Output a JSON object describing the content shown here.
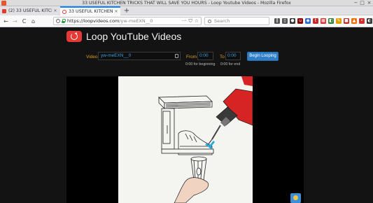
{
  "window": {
    "title": "33 USEFUL KITCHEN TRICKS THAT WILL SAVE YOU HOURS - Loop Youtube Videos - Mozilla Firefox",
    "controls": [
      "−",
      "□",
      "×"
    ]
  },
  "tabs": [
    {
      "label": "(2) 33 USEFUL KITCHEN",
      "active": false,
      "close": "×"
    },
    {
      "label": "33 USEFUL KITCHEN TR",
      "active": true,
      "close": "×"
    }
  ],
  "new_tab": "+",
  "nav": {
    "back": "←",
    "forward": "→",
    "reload": "C",
    "home": "⌂",
    "url_host": "https://loopvideos.com",
    "url_path": "/yw-meEXN__0",
    "url_actions": [
      "···",
      "⛉",
      "☆"
    ],
    "search_placeholder": "Search"
  },
  "toolbar_icons": [
    {
      "name": "library-icon",
      "color": "#555555",
      "glyph": "‖"
    },
    {
      "name": "sidebar-icon",
      "color": "#555555",
      "glyph": "▯"
    },
    {
      "name": "ext-dark-icon",
      "color": "#333333",
      "glyph": "●"
    },
    {
      "name": "ext-ublock-icon",
      "color": "#8b0000",
      "glyph": "u"
    },
    {
      "name": "ext-blue-icon",
      "color": "#2f6fc9",
      "glyph": "◆"
    },
    {
      "name": "ext-tag-icon",
      "color": "#c62828",
      "glyph": "t"
    },
    {
      "name": "ext-grid-icon",
      "color": "#d32f2f",
      "glyph": "▦"
    },
    {
      "name": "ext-green-icon",
      "color": "#2e7d32",
      "glyph": "◧"
    },
    {
      "name": "ext-pen-icon",
      "color": "#e0a000",
      "glyph": "✎"
    },
    {
      "name": "ext-square-icon",
      "color": "#c62828",
      "glyph": "■"
    },
    {
      "name": "ext-orange-icon",
      "color": "#ef6c00",
      "glyph": "▲"
    },
    {
      "name": "ext-lastpass-icon",
      "color": "#d32f2f",
      "glyph": "•"
    },
    {
      "name": "ext-vpn-icon",
      "color": "#333333",
      "glyph": "◐"
    },
    {
      "name": "ext-loop-icon",
      "color": "#e53935",
      "glyph": "↻"
    },
    {
      "name": "menu-icon",
      "color": "#555555",
      "glyph": "≡"
    }
  ],
  "brand": {
    "name": "Loop YouTube Videos",
    "color": "#e53935"
  },
  "form": {
    "video_label": "Video:",
    "video_value": "yw-meEXN__0",
    "from_label": "From",
    "from_value": "0:00",
    "to_label": "To",
    "to_value": "0:00",
    "from_hint": "0:00 for beginning",
    "to_hint": "0:00 for end",
    "button_label": "Begin Looping"
  },
  "colors": {
    "accent": "#2f7fc8",
    "label": "#d6a017",
    "input_text": "#3ba0e6",
    "page_bg": "#131313"
  }
}
